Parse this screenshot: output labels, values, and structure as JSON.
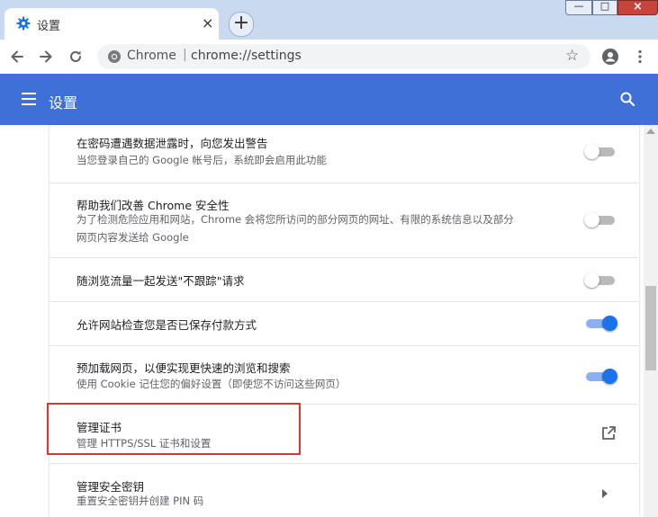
{
  "tab": {
    "title": "设置",
    "close": "×",
    "new_tab": "+"
  },
  "window_controls": {
    "minimize": "—",
    "maximize": "□",
    "close": "×"
  },
  "omnibox": {
    "site_label": "Chrome",
    "separator": "|",
    "url": "chrome://settings"
  },
  "app": {
    "title": "设置"
  },
  "rows": [
    {
      "title": "在密码遭遇数据泄露时，向您发出警告",
      "subtitle": "当您登录自己的 Google 帐号后，系统即会启用此功能",
      "control": "toggle",
      "enabled": false
    },
    {
      "title": "帮助我们改善 Chrome 安全性",
      "subtitle_lines": [
        "为了检测危险应用和网站，Chrome 会将您所访问的部分网页的网址、有限的系统信息以及部分",
        "网页内容发送给 Google"
      ],
      "control": "toggle",
      "enabled": false
    },
    {
      "title": "随浏览流量一起发送\"不跟踪\"请求",
      "control": "toggle",
      "enabled": false
    },
    {
      "title": "允许网站检查您是否已保存付款方式",
      "control": "toggle",
      "enabled": true
    },
    {
      "title": "预加载网页，以便实现更快速的浏览和搜索",
      "subtitle": "使用 Cookie 记住您的偏好设置（即使您不访问这些网页）",
      "control": "toggle",
      "enabled": true
    },
    {
      "title": "管理证书",
      "subtitle": "管理 HTTPS/SSL 证书和设置",
      "control": "external-link-icon"
    },
    {
      "title": "管理安全密钥",
      "subtitle": "重置安全密钥并创建 PIN 码",
      "control": "chevron-right-icon"
    }
  ],
  "colors": {
    "accent": "#1a73e8",
    "header": "#3f70d8",
    "highlight_border": "#d93636"
  }
}
